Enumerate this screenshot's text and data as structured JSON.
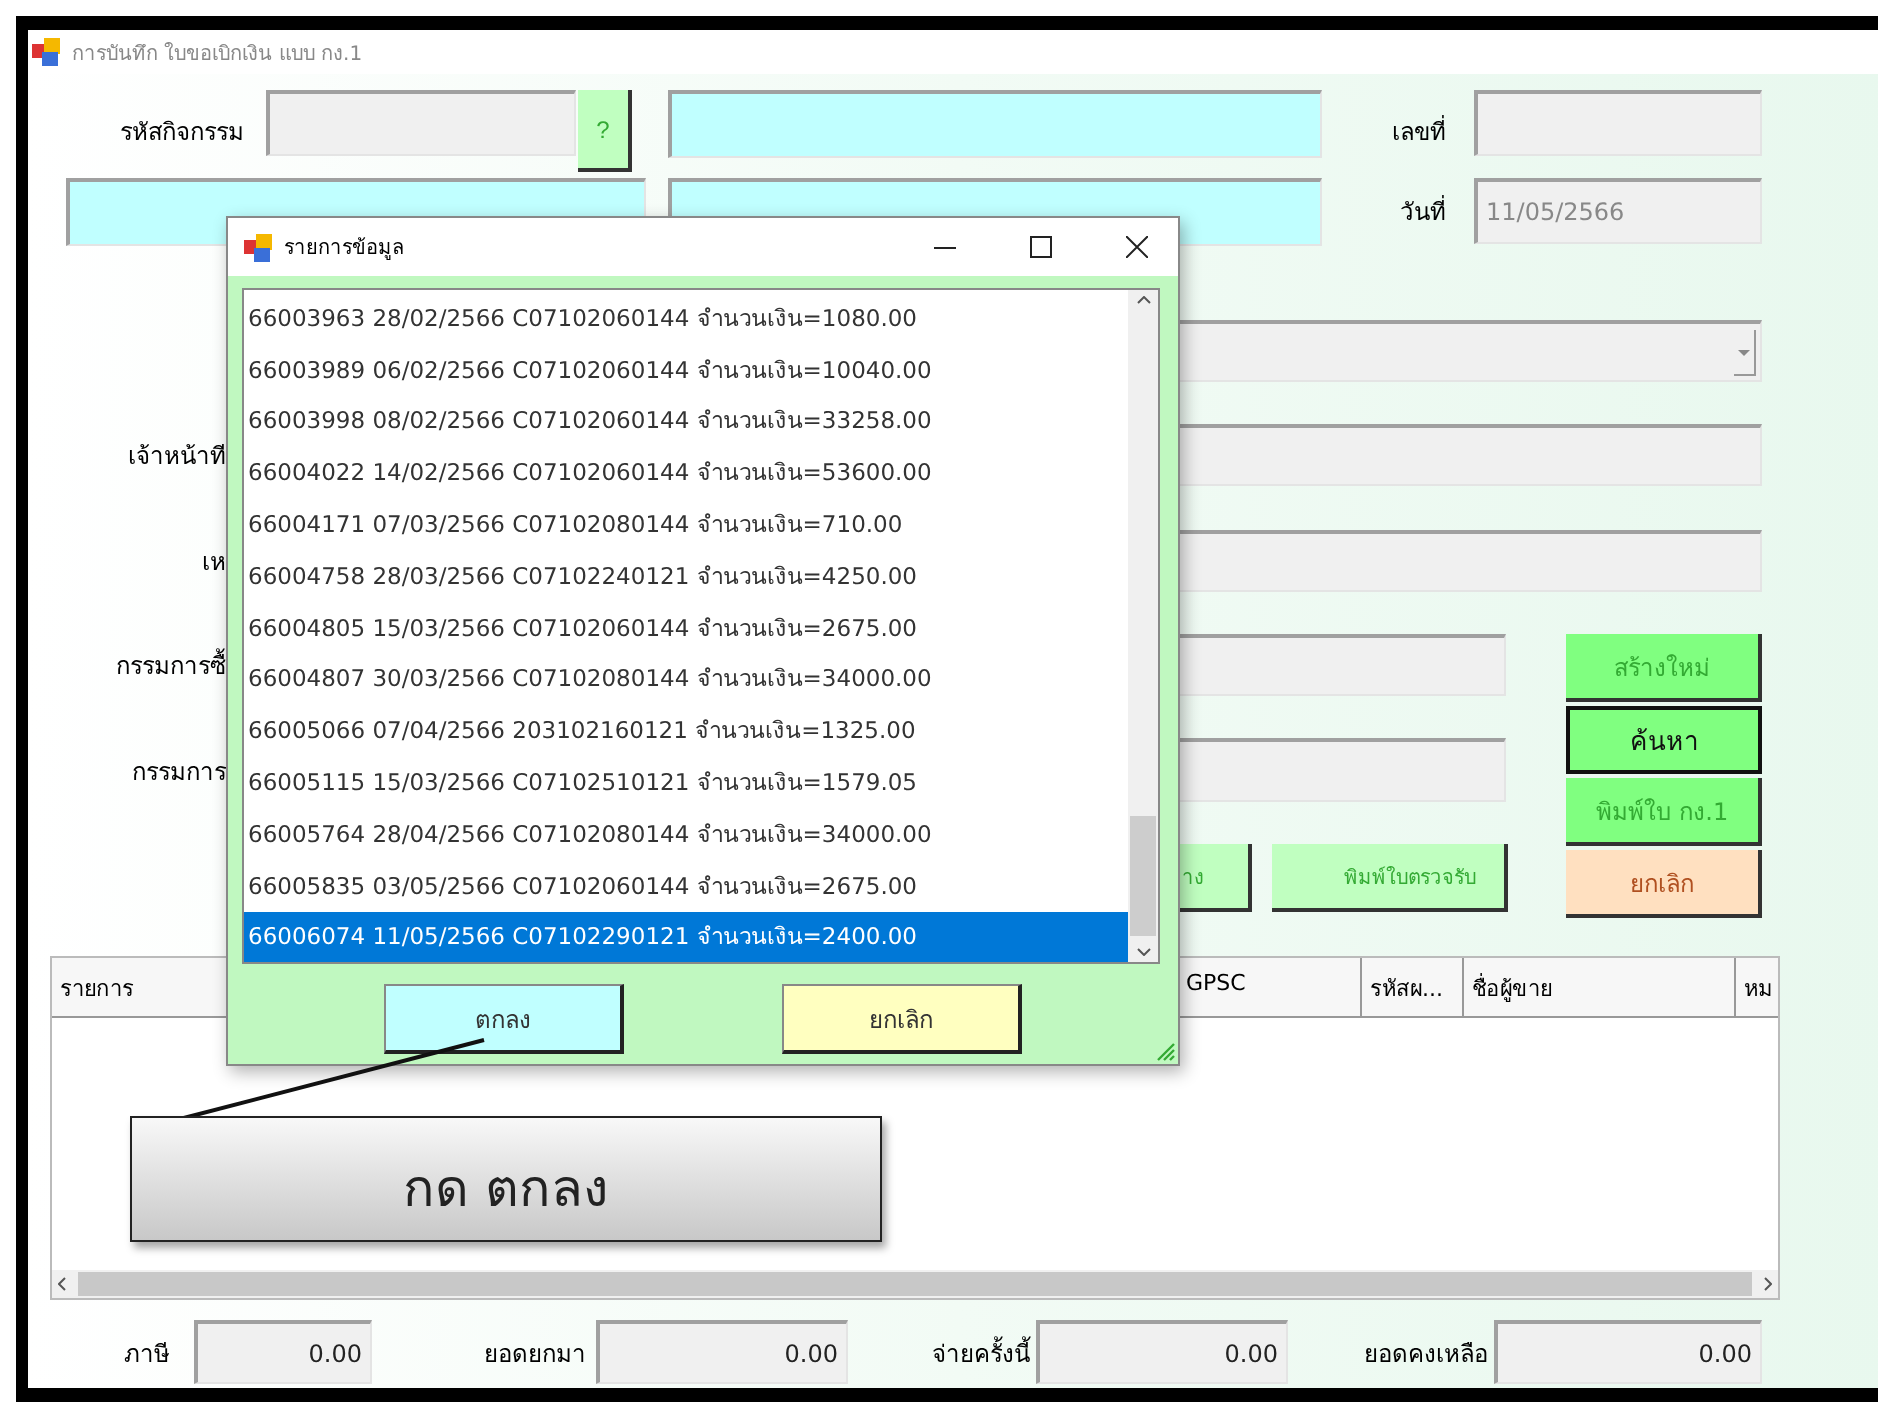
{
  "window": {
    "title": "การบันทึก ใบขอเบิกเงิน แบบ กง.1"
  },
  "form": {
    "activity_code_label": "รหัสกิจกรรม",
    "lookup_button": "?",
    "number_label": "เลขที่",
    "date_label": "วันที่",
    "date_value": "11/05/2566",
    "officer_label": "เจ้าหน้าที",
    "row5_label": "เห",
    "committee_buy_label": "กรรมการซื้",
    "committee_label": "กรรมการ"
  },
  "row_buttons": [
    {
      "label": "าง"
    },
    {
      "label": "พิมพ์ใบตรวจรับ"
    }
  ],
  "side_buttons": [
    {
      "label": "สร้างใหม่",
      "kind": "green"
    },
    {
      "label": "ค้นหา",
      "kind": "focused"
    },
    {
      "label": "พิมพ์ใบ กง.1",
      "kind": "green"
    },
    {
      "label": "ยกเลิก",
      "kind": "cancel"
    }
  ],
  "table": {
    "columns": [
      "รายการ",
      "GPSC",
      "รหัสผ...",
      "ชื่อผู้ขาย",
      "หม"
    ]
  },
  "totals": [
    {
      "label": "ภาษี",
      "value": "0.00"
    },
    {
      "label": "ยอดยกมา",
      "value": "0.00"
    },
    {
      "label": "จ่ายครั้งนี้",
      "value": "0.00"
    },
    {
      "label": "ยอดคงเหลือ",
      "value": "0.00"
    }
  ],
  "dialog": {
    "title": "รายการข้อมูล",
    "items": [
      {
        "text": "66003963 28/02/2566 C07102060144 จำนวนเงิน=1080.00",
        "selected": false
      },
      {
        "text": "66003989 06/02/2566 C07102060144 จำนวนเงิน=10040.00",
        "selected": false
      },
      {
        "text": "66003998 08/02/2566 C07102060144 จำนวนเงิน=33258.00",
        "selected": false
      },
      {
        "text": "66004022 14/02/2566 C07102060144 จำนวนเงิน=53600.00",
        "selected": false
      },
      {
        "text": "66004171 07/03/2566 C07102080144 จำนวนเงิน=710.00",
        "selected": false
      },
      {
        "text": "66004758 28/03/2566 C07102240121 จำนวนเงิน=4250.00",
        "selected": false
      },
      {
        "text": "66004805 15/03/2566 C07102060144 จำนวนเงิน=2675.00",
        "selected": false
      },
      {
        "text": "66004807 30/03/2566 C07102080144 จำนวนเงิน=34000.00",
        "selected": false
      },
      {
        "text": "66005066 07/04/2566 203102160121 จำนวนเงิน=1325.00",
        "selected": false
      },
      {
        "text": "66005115 15/03/2566 C07102510121 จำนวนเงิน=1579.05",
        "selected": false
      },
      {
        "text": "66005764 28/04/2566 C07102080144 จำนวนเงิน=34000.00",
        "selected": false
      },
      {
        "text": "66005835 03/05/2566 C07102060144 จำนวนเงิน=2675.00",
        "selected": false
      },
      {
        "text": "66006074 11/05/2566 C07102290121 จำนวนเงิน=2400.00",
        "selected": true
      }
    ],
    "buttons": [
      {
        "label": "ตกลง",
        "kind": "ok"
      },
      {
        "label": "ยกเลิก",
        "kind": "cancel"
      }
    ]
  },
  "callout": {
    "text": "กด ตกลง"
  }
}
